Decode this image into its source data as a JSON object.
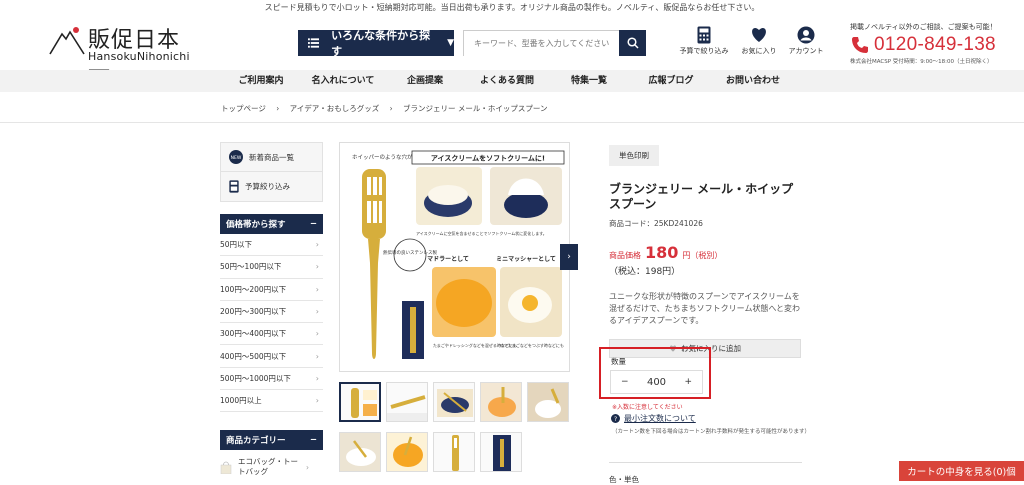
{
  "topbar": {
    "text": "スピード見積もりで小ロット・短納期対応可能。当日出荷も承ります。オリジナル商品の製作も。ノベルティ、販促品ならお任せ下さい。"
  },
  "logo": {
    "jp": "販促日本一",
    "en": "HansokuNihonichi"
  },
  "header": {
    "conditions_button": "いろんな条件から探す",
    "search_placeholder": "キーワード、型番を入力してください",
    "budget_label": "予算で絞り込み",
    "favorites_label": "お気に入り",
    "account_label": "アカウント",
    "contact_note": "掲載ノベルティ以外のご相談、ご提案も可能！",
    "phone": "0120-849-138",
    "company_hours": "株式会社MACSP 受付時間：9:00〜18:00（土日祝除く）"
  },
  "nav": [
    "ご利用案内",
    "名入れについて",
    "企画提案",
    "よくある質問",
    "特集一覧",
    "広報ブログ",
    "お問い合わせ"
  ],
  "breadcrumb": [
    "トップページ",
    "›",
    "アイデア・おもしろグッズ",
    "›",
    "ブランジェリー メール・ホイップスプーン"
  ],
  "sidebar": {
    "new_items": "新着商品一覧",
    "budget": "予算絞り込み",
    "price_header": "価格帯から探す",
    "price_ranges": [
      "50円以下",
      "50円〜100円以下",
      "100円〜200円以下",
      "200円〜300円以下",
      "300円〜400円以下",
      "400円〜500円以下",
      "500円〜1000円以下",
      "1000円以上"
    ],
    "category_header": "商品カテゴリー",
    "categories": [
      "エコバッグ・トートバッグ"
    ]
  },
  "product_image": {
    "label_holes": "ホイッパーのような穴が開いた形状",
    "label_title": "アイスクリームをソフトクリームに!",
    "label_air": "アイスクリームに空気を含ませることでソフトクリーム状に変化します。",
    "label_steel": "熱伝導の良いステンレス製",
    "label_muddler": "マドラーとして",
    "label_masher": "ミニマッシャーとして",
    "label_dressing": "たまごやドレッシングなどを混ぜる時などにも",
    "label_boiled": "ゆでたまごなどをつぶす時などにも"
  },
  "product": {
    "tag": "単色印刷",
    "title": "ブランジェリー メール・ホイップスプーン",
    "code_label": "商品コード：",
    "code": "25KD241026",
    "price_label": "商品価格",
    "price": "180",
    "price_unit": "円（税別）",
    "price_tax": "（税込：198円）",
    "description": "ユニークな形状が特徴のスプーンでアイスクリームを混ぜるだけで、たちまちソフトクリーム状態へと変わるアイデアスプーンです。",
    "favorite_button": "お気に入りに追加",
    "qty_label": "数量",
    "qty_minus": "−",
    "qty_value": "400",
    "qty_plus": "+",
    "qty_note": "※入数に注意してください",
    "min_order_link": "最小注文数について",
    "min_order_note": "（カートン数を下回る場合はカートン割れ手数料が発生する可能性があります）",
    "color_label": "色・単色"
  },
  "cart_button": "カートの中身を見る(0)個"
}
